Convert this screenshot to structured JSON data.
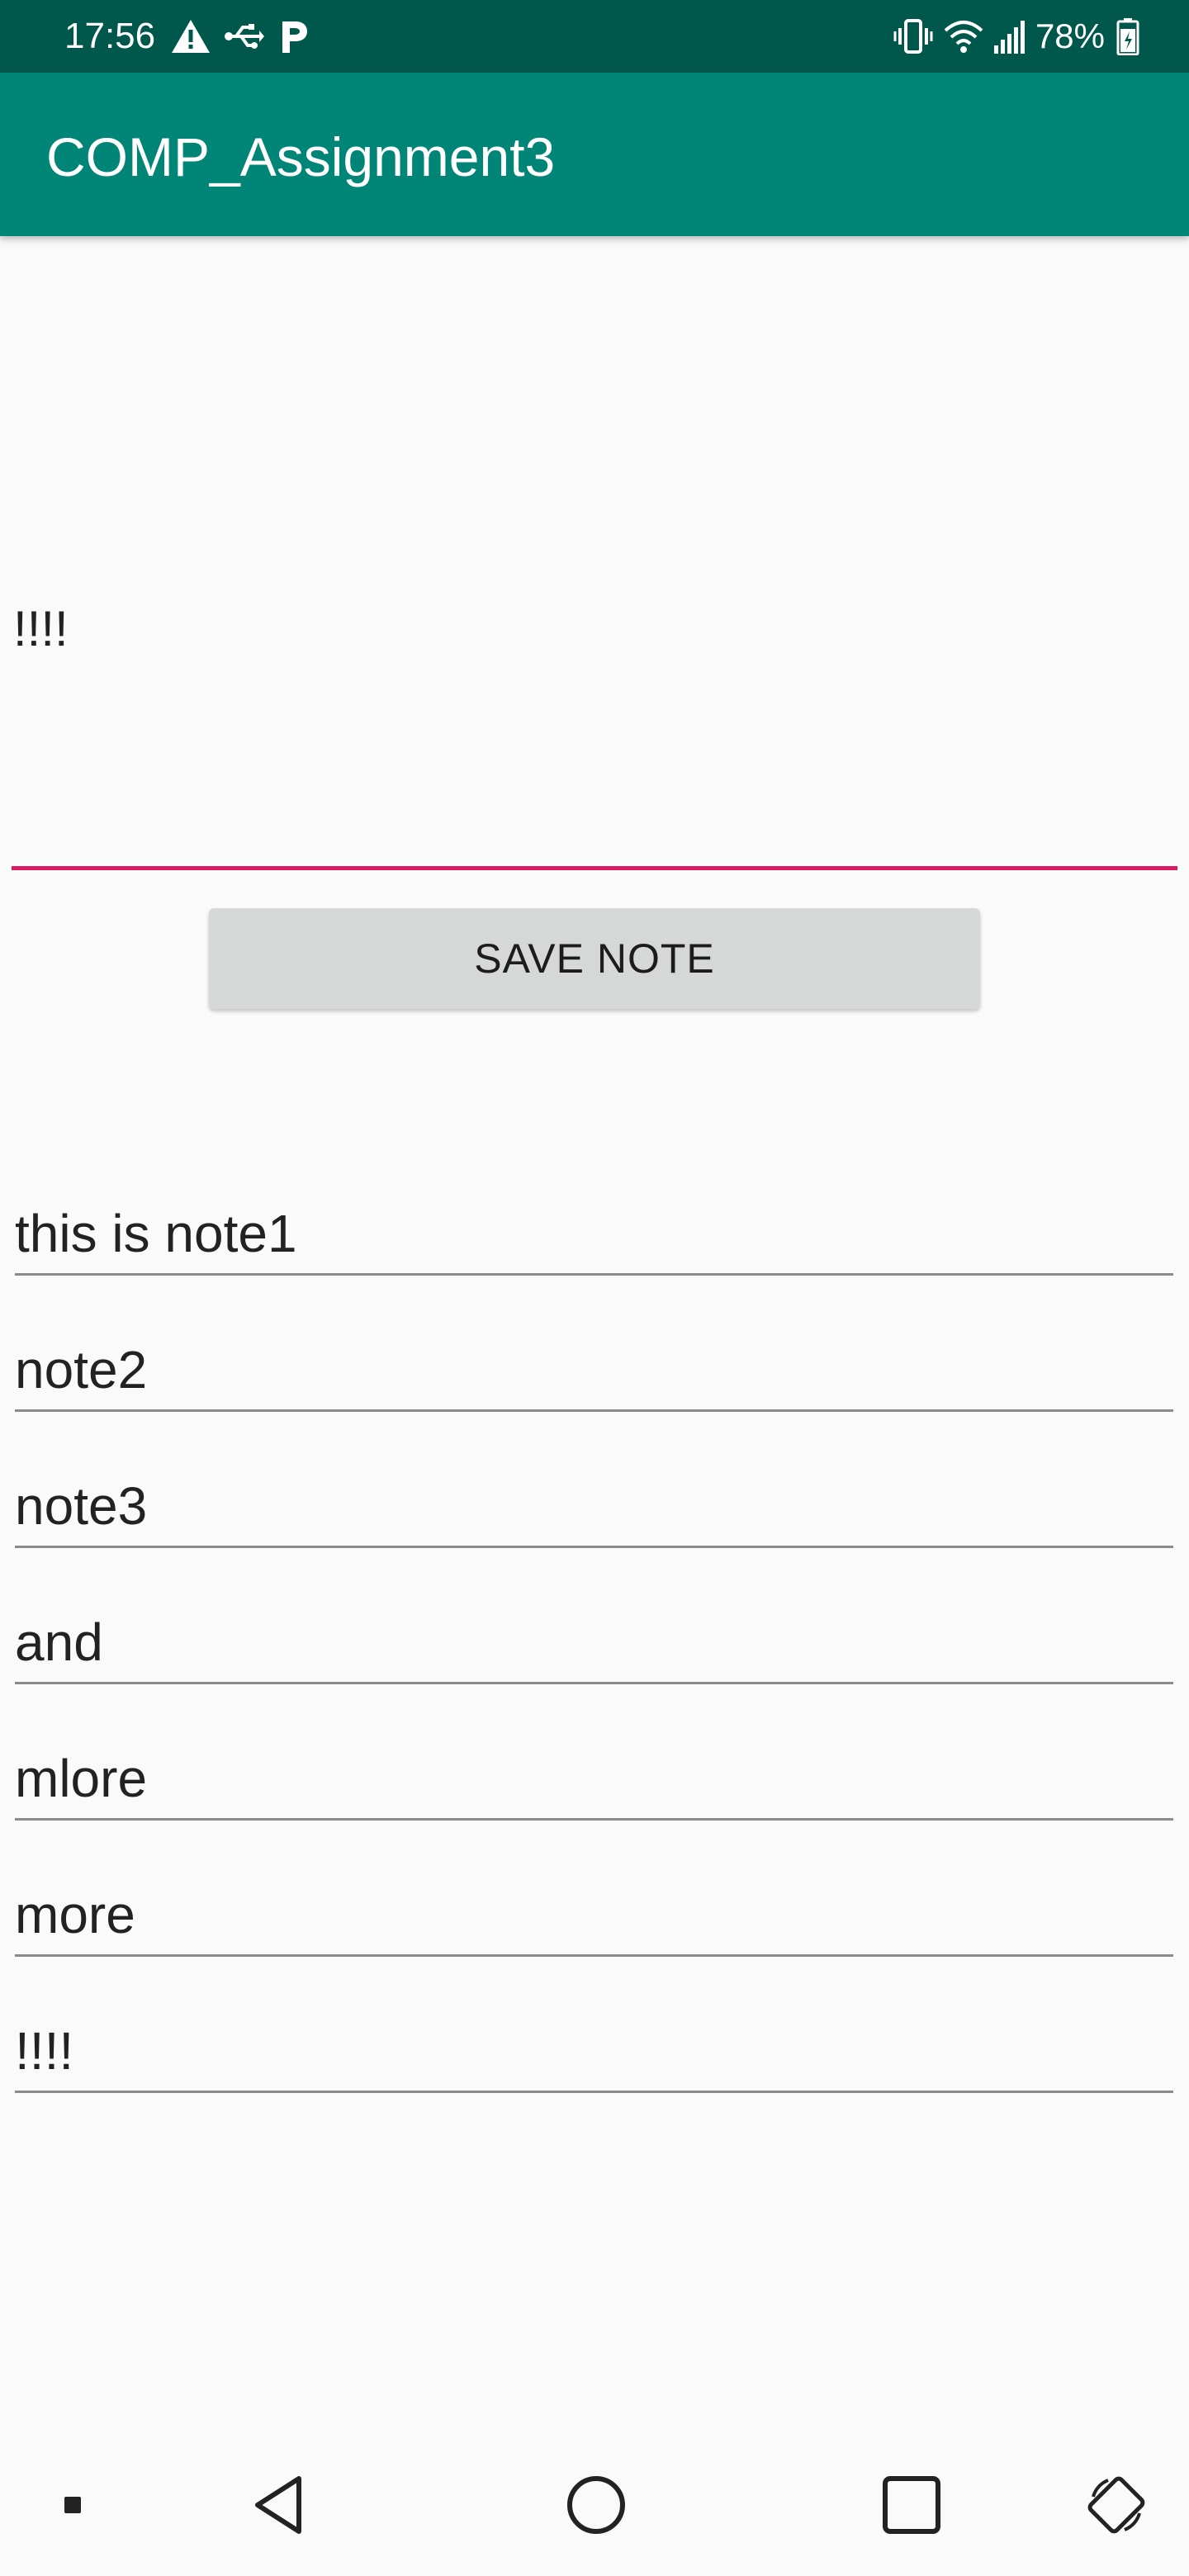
{
  "status_bar": {
    "time": "17:56",
    "left_icons": [
      "warning-icon",
      "usb-icon",
      "parking-icon"
    ],
    "right_icons": [
      "vibrate-icon",
      "wifi-icon",
      "signal-icon",
      "battery-icon"
    ],
    "battery_percent": "78%"
  },
  "app_bar": {
    "title": "COMP_Assignment3"
  },
  "note_input": {
    "value": "!!!!"
  },
  "save_button": {
    "label": "SAVE NOTE"
  },
  "notes": [
    {
      "text": "this is note1"
    },
    {
      "text": "note2"
    },
    {
      "text": "note3"
    },
    {
      "text": "and"
    },
    {
      "text": "mlore"
    },
    {
      "text": "more"
    },
    {
      "text": "!!!!"
    }
  ],
  "nav_bar": {
    "buttons": [
      "dot-icon",
      "back-icon",
      "home-icon",
      "recents-icon",
      "rotate-icon"
    ]
  },
  "colors": {
    "status_bar": "#00574b",
    "app_bar": "#008577",
    "accent": "#d81b60",
    "background": "#fafafa"
  }
}
